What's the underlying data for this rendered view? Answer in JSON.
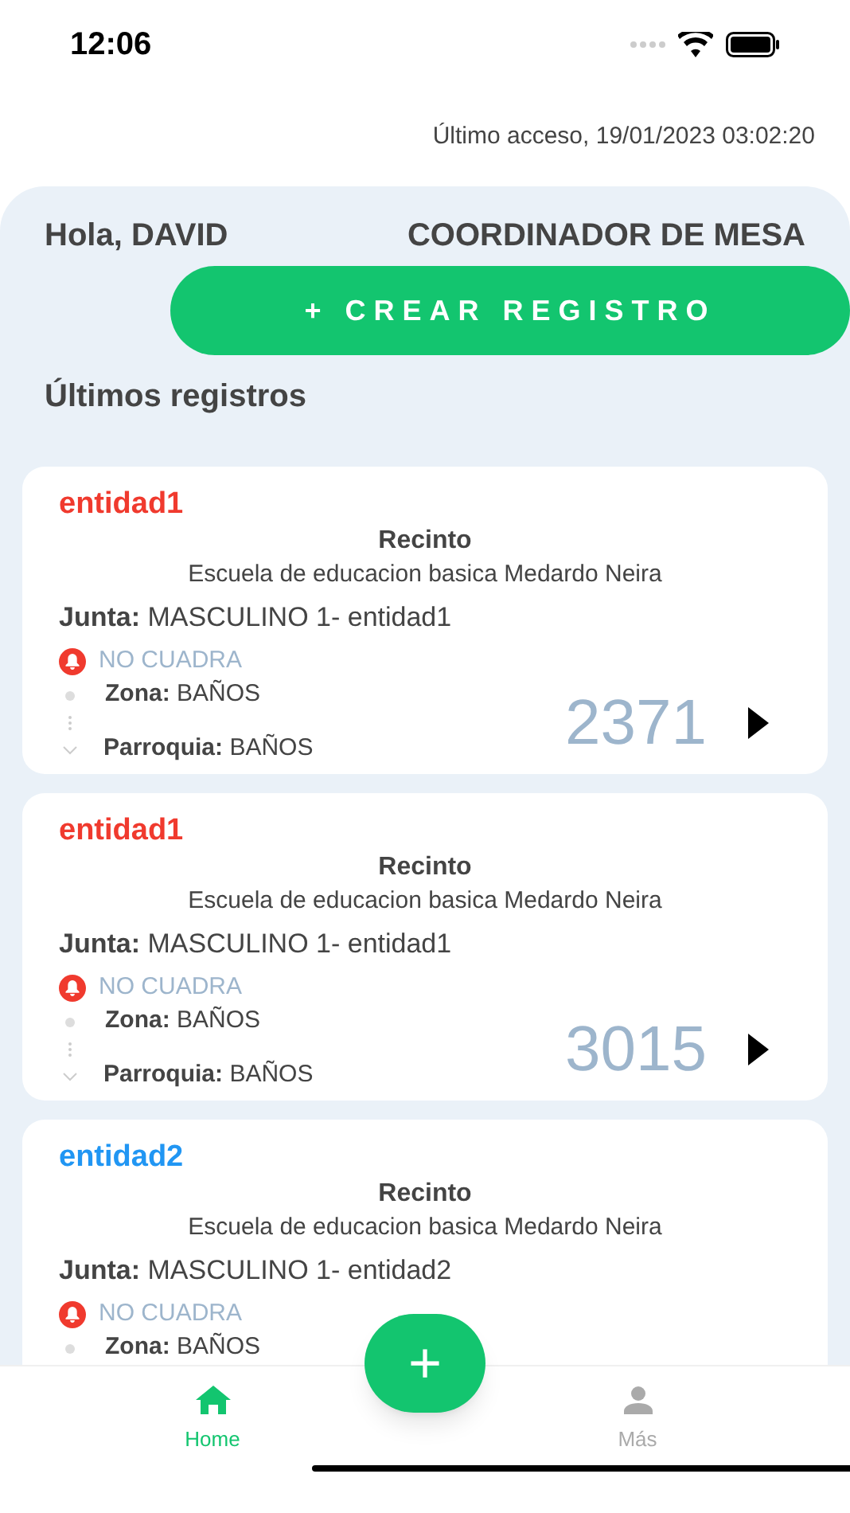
{
  "status_bar": {
    "time": "12:06"
  },
  "last_access": "Último acceso, 19/01/2023 03:02:20",
  "greeting": "Hola, DAVID",
  "role": "COORDINADOR DE MESA",
  "create_button": "+ CREAR REGISTRO",
  "section_title": "Últimos registros",
  "records": [
    {
      "entity": "entidad1",
      "color": "#f03a2e",
      "recinto_label": "Recinto",
      "recinto": "Escuela de educacion basica Medardo Neira",
      "junta_label": "Junta:",
      "junta": "MASCULINO 1- entidad1",
      "status": "NO CUADRA",
      "zona_label": "Zona:",
      "zona": "BAÑOS",
      "parroquia_label": "Parroquia:",
      "parroquia": "BAÑOS",
      "total": "2371"
    },
    {
      "entity": "entidad1",
      "color": "#f03a2e",
      "recinto_label": "Recinto",
      "recinto": "Escuela de educacion basica Medardo Neira",
      "junta_label": "Junta:",
      "junta": "MASCULINO 1- entidad1",
      "status": "NO CUADRA",
      "zona_label": "Zona:",
      "zona": "BAÑOS",
      "parroquia_label": "Parroquia:",
      "parroquia": "BAÑOS",
      "total": "3015"
    },
    {
      "entity": "entidad2",
      "color": "#2196f3",
      "recinto_label": "Recinto",
      "recinto": "Escuela de educacion basica Medardo Neira",
      "junta_label": "Junta:",
      "junta": "MASCULINO 1- entidad2",
      "status": "NO CUADRA",
      "zona_label": "Zona:",
      "zona": "BAÑOS"
    }
  ],
  "fab": "+",
  "tabs": [
    {
      "label": "Home",
      "selected": true
    },
    {
      "label": "Más",
      "selected": false
    }
  ]
}
